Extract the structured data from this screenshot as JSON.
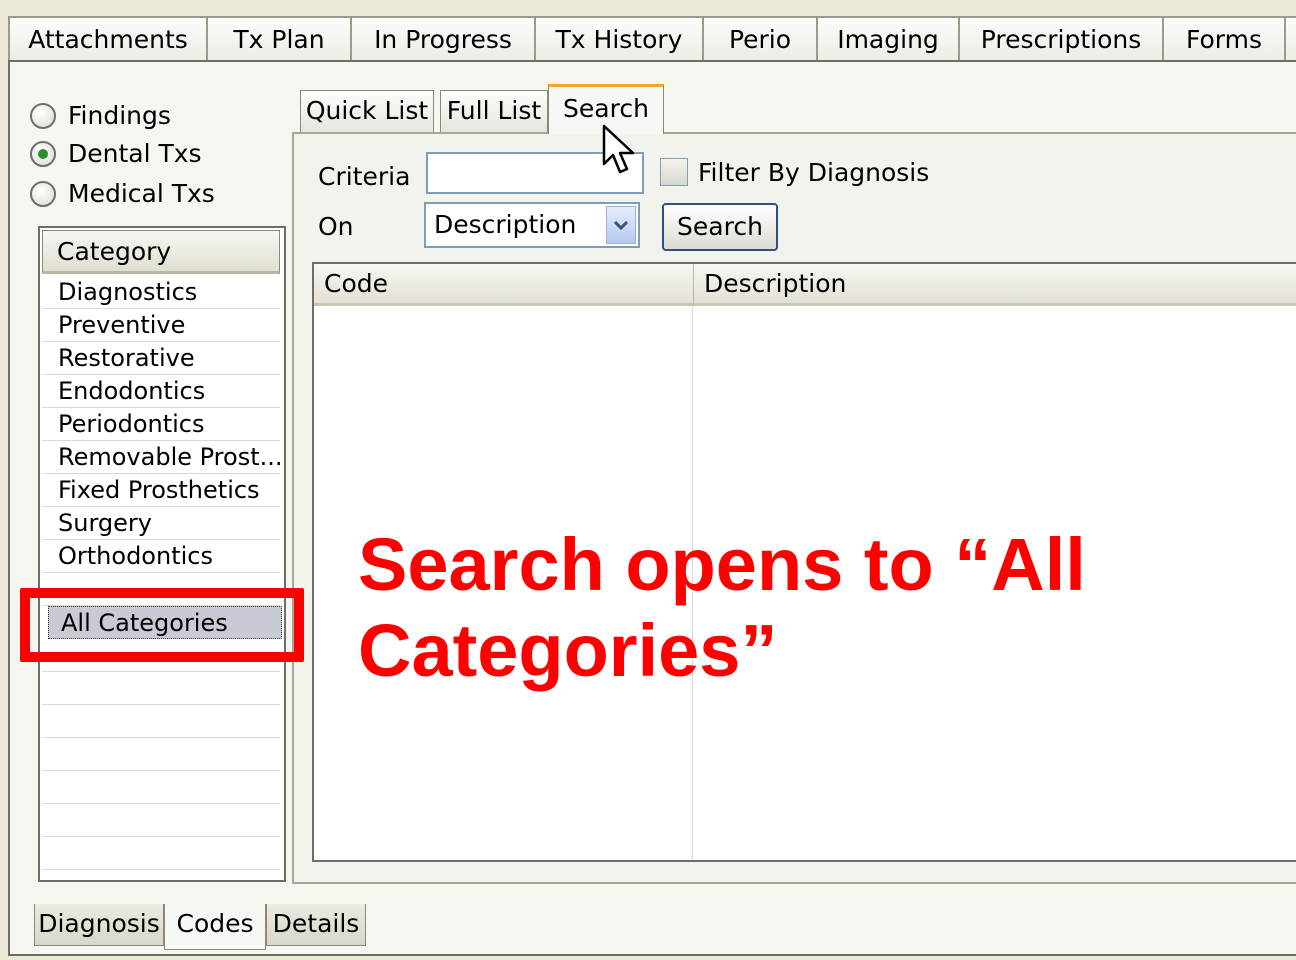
{
  "top_tabs": [
    "Attachments",
    "Tx Plan",
    "In Progress",
    "Tx History",
    "Perio",
    "Imaging",
    "Prescriptions",
    "Forms"
  ],
  "radios": [
    {
      "label": "Findings",
      "checked": false
    },
    {
      "label": "Dental Txs",
      "checked": true
    },
    {
      "label": "Medical Txs",
      "checked": false
    }
  ],
  "category": {
    "header": "Category",
    "items": [
      "Diagnostics",
      "Preventive",
      "Restorative",
      "Endodontics",
      "Periodontics",
      "Removable Prost...",
      "Fixed Prosthetics",
      "Surgery",
      "Orthodontics"
    ],
    "selected_item": "All Categories"
  },
  "inner_tabs": [
    "Quick List",
    "Full List",
    "Search"
  ],
  "active_inner_tab": "Search",
  "search_form": {
    "criteria_label": "Criteria",
    "criteria_value": "",
    "on_label": "On",
    "on_value": "Description",
    "filter_label": "Filter By Diagnosis",
    "filter_checked": false,
    "search_button": "Search"
  },
  "grid": {
    "columns": [
      "Code",
      "Description"
    ],
    "rows": []
  },
  "bottom_tabs": [
    "Diagnosis",
    "Codes",
    "Details"
  ],
  "active_bottom_tab": "Codes",
  "annotation": {
    "line1": "Search opens to “All",
    "line2": "Categories”",
    "color": "#ff0000"
  },
  "colors": {
    "accent_tab": "#f0a830",
    "radio_dot": "#2f8f2f",
    "highlight": "#ff0000"
  }
}
